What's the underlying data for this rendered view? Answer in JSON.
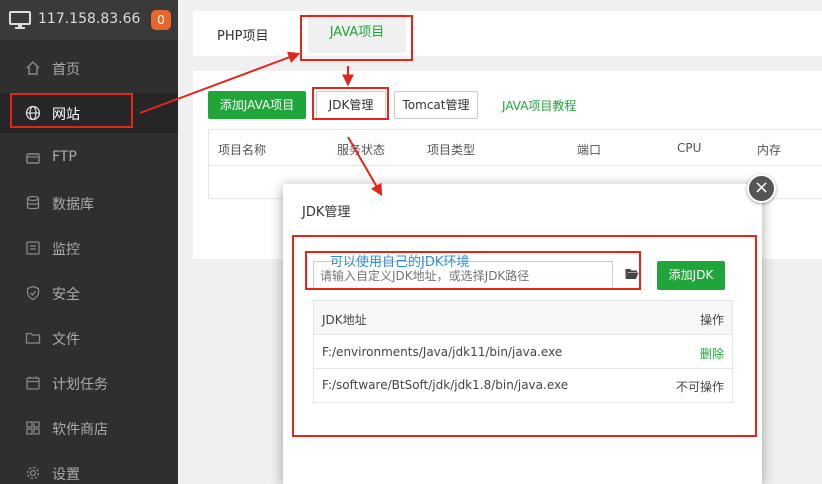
{
  "server": {
    "ip": "117.158.83.66",
    "badge": "0"
  },
  "sidebar": {
    "items": [
      {
        "label": "首页",
        "icon": "home-icon"
      },
      {
        "label": "网站",
        "icon": "globe-icon"
      },
      {
        "label": "FTP",
        "icon": "ftp-icon"
      },
      {
        "label": "数据库",
        "icon": "database-icon"
      },
      {
        "label": "监控",
        "icon": "monitor-icon"
      },
      {
        "label": "安全",
        "icon": "shield-icon"
      },
      {
        "label": "文件",
        "icon": "folder-icon"
      },
      {
        "label": "计划任务",
        "icon": "calendar-icon"
      },
      {
        "label": "软件商店",
        "icon": "apps-icon"
      },
      {
        "label": "设置",
        "icon": "gear-icon"
      }
    ],
    "active": "网站"
  },
  "tabs": {
    "php": "PHP项目",
    "java": "JAVA项目"
  },
  "toolbar": {
    "add_java": "添加JAVA项目",
    "jdk_manage": "JDK管理",
    "tomcat_manage": "Tomcat管理",
    "tutorial": "JAVA项目教程"
  },
  "project_table": {
    "headers": [
      "项目名称",
      "服务状态",
      "项目类型",
      "端口",
      "CPU",
      "内存"
    ]
  },
  "modal": {
    "title": "JDK管理",
    "annotation": "可以使用自己的JDK环境",
    "input_placeholder": "请输入自定义JDK地址，或选择JDK路径",
    "add_button": "添加JDK",
    "table": {
      "header_path": "JDK地址",
      "header_op": "操作",
      "rows": [
        {
          "path": "F:/environments/Java/jdk11/bin/java.exe",
          "op": "删除"
        },
        {
          "path": "F:/software/BtSoft/jdk/jdk1.8/bin/java.exe",
          "op": "不可操作"
        }
      ]
    }
  },
  "colors": {
    "accent": "#20a53a",
    "annotation_red": "#e2261a",
    "annotation_blue": "#2f8fd6",
    "sidebar_bg": "#2f2f2f"
  }
}
